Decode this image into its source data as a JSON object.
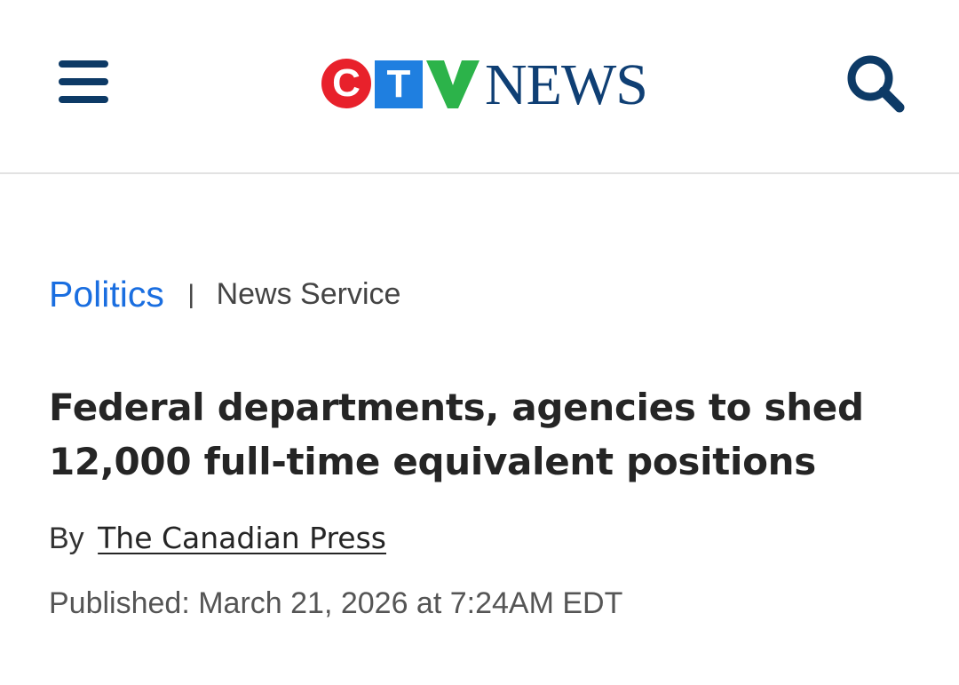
{
  "header": {
    "brand": {
      "letters": [
        "C",
        "T",
        "V"
      ],
      "wordmark": "NEWS",
      "colors": {
        "c_circle": "#e8212b",
        "t_square": "#1f7fe0",
        "v_mark": "#2cb34a",
        "wordmark": "#0f3f74"
      }
    },
    "menu_icon": "hamburger-menu-icon",
    "search_icon": "search-icon",
    "icon_color": "#0d3a66"
  },
  "article": {
    "category": "Politics",
    "separator": "|",
    "service": "News Service",
    "headline": "Federal departments, agencies to shed 12,000 full-time equivalent positions",
    "byline_prefix": "By",
    "author": "The Canadian Press",
    "published": "Published: March 21, 2026 at 7:24AM EDT"
  },
  "colors": {
    "category_link": "#1a6ee0",
    "divider": "#e2e2e2"
  }
}
